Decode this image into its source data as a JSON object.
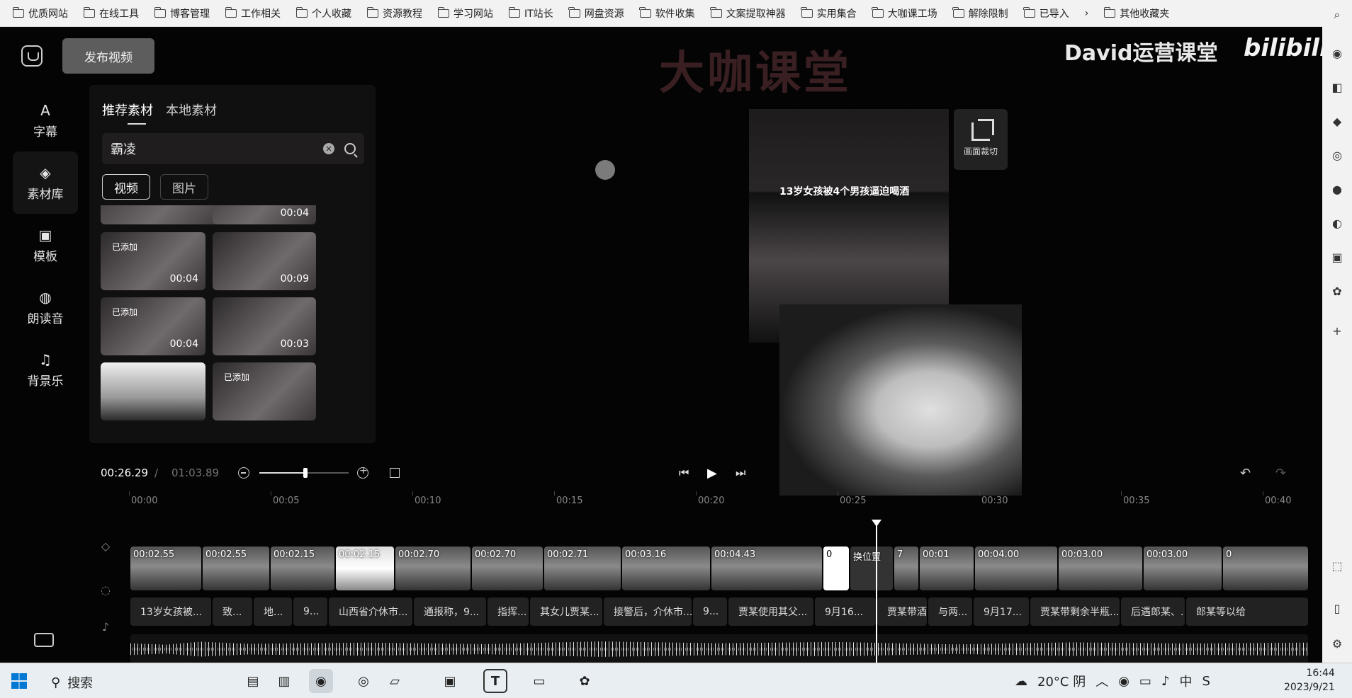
{
  "bookmarks": [
    "优质网站",
    "在线工具",
    "博客管理",
    "工作相关",
    "个人收藏",
    "资源教程",
    "学习网站",
    "IT站长",
    "网盘资源",
    "软件收集",
    "文案提取神器",
    "实用集合",
    "大咖课工场",
    "解除限制",
    "已导入",
    "其他收藏夹"
  ],
  "overlay": {
    "watermark": "大咖课堂",
    "brand": "David运营课堂",
    "bilibili": "bilibili"
  },
  "header": {
    "publish_label": "发布视频"
  },
  "rail": [
    {
      "icon": "A",
      "label": "字幕"
    },
    {
      "icon": "◈",
      "label": "素材库"
    },
    {
      "icon": "▣",
      "label": "模板"
    },
    {
      "icon": "◍",
      "label": "朗读音"
    },
    {
      "icon": "♫",
      "label": "背景乐"
    }
  ],
  "panel": {
    "tabs": [
      "推荐素材",
      "本地素材"
    ],
    "search_value": "霸凌",
    "filters": [
      "视频",
      "图片"
    ],
    "thumbs": [
      {
        "added": "",
        "duration": ""
      },
      {
        "added": "",
        "duration": "00:04"
      },
      {
        "added": "已添加",
        "duration": "00:04"
      },
      {
        "added": "",
        "duration": "00:09"
      },
      {
        "added": "已添加",
        "duration": "00:04"
      },
      {
        "added": "",
        "duration": "00:03"
      },
      {
        "added": "",
        "duration": ""
      },
      {
        "added": "已添加",
        "duration": ""
      }
    ]
  },
  "preview": {
    "caption": "13岁女孩被4个男孩逼迫喝酒",
    "crop_label": "画面裁切"
  },
  "timeline": {
    "current": "00:26.29",
    "separator": "/",
    "total": "01:03.89",
    "ruler": [
      "00:00",
      "00:05",
      "00:10",
      "00:15",
      "00:20",
      "00:25",
      "00:30",
      "00:35",
      "00:40"
    ],
    "clips": [
      "00:02.55",
      "00:02.55",
      "00:02.15",
      "00:02.15",
      "00:02.70",
      "00:02.70",
      "00:02.71",
      "00:03.16",
      "00:04.43",
      "0",
      "7",
      "00:01",
      "00:04.00",
      "00:03.00",
      "00:03.00",
      "0"
    ],
    "clip_overlay": "换位置",
    "captions": [
      "13岁女孩被...",
      "致...",
      "地...",
      "9...",
      "山西省介休市...",
      "通报称，9...",
      "指挥...",
      "其女儿贾某...",
      "接警后，介休市...",
      "9...",
      "贾某使用其父...",
      "9月16...",
      "贾某带酒...",
      "与两...",
      "9月17...",
      "贾某带剩余半瓶...",
      "后遇郎某、...",
      "郎某等以给"
    ]
  },
  "taskbar": {
    "search_label": "搜索",
    "weather": "20°C 阴",
    "ime": "中",
    "time": "16:44",
    "date": "2023/9/21"
  }
}
